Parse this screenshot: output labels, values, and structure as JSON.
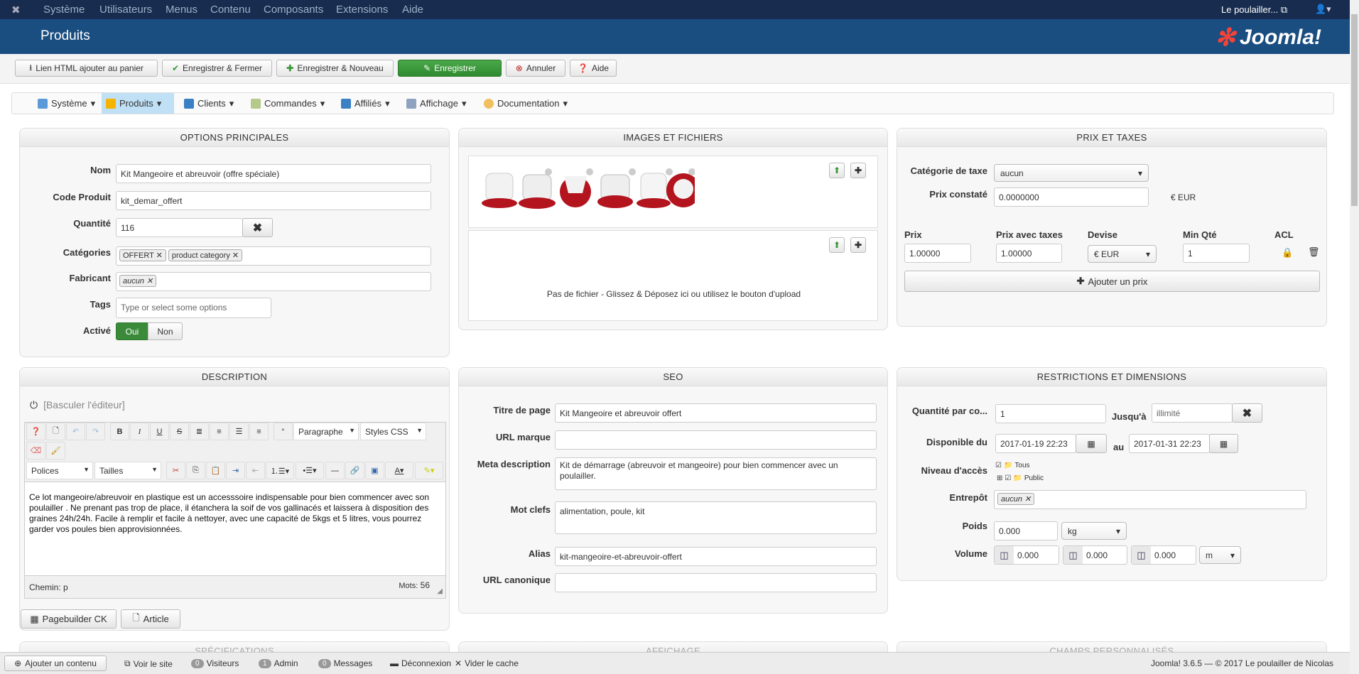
{
  "topnav": {
    "items": [
      "Système",
      "Utilisateurs",
      "Menus",
      "Contenu",
      "Composants",
      "Extensions",
      "Aide"
    ],
    "site": "Le poulailler...",
    "user_icon": "user-icon"
  },
  "header": {
    "title": "Produits",
    "logo": "Joomla!"
  },
  "toolbar": {
    "link_html": "Lien HTML ajouter au panier",
    "save_close": "Enregistrer & Fermer",
    "save_new": "Enregistrer & Nouveau",
    "save": "Enregistrer",
    "cancel": "Annuler",
    "help": "Aide"
  },
  "submenu": {
    "items": [
      "Système",
      "Produits",
      "Clients",
      "Commandes",
      "Affiliés",
      "Affichage",
      "Documentation"
    ],
    "active": "Produits"
  },
  "options": {
    "title": "OPTIONS PRINCIPALES",
    "nom_label": "Nom",
    "nom": "Kit Mangeoire et abreuvoir (offre spéciale)",
    "code_label": "Code Produit",
    "code": "kit_demar_offert",
    "qte_label": "Quantité",
    "qte": "116",
    "cat_label": "Catégories",
    "cats": [
      "OFFERT",
      "product category"
    ],
    "fab_label": "Fabricant",
    "fab": "aucun",
    "tags_label": "Tags",
    "tags_placeholder": "Type or select some options",
    "actif_label": "Activé",
    "oui": "Oui",
    "non": "Non"
  },
  "images": {
    "title": "IMAGES ET FICHIERS",
    "nofile": "Pas de fichier - Glissez & Déposez ici ou utilisez le bouton d'upload"
  },
  "prix": {
    "title": "PRIX ET TAXES",
    "taxe_label": "Catégorie de taxe",
    "taxe": "aucun",
    "constate_label": "Prix constaté",
    "constate": "0.0000000",
    "constate_cur": "€ EUR",
    "cols": [
      "Prix",
      "Prix avec taxes",
      "Devise",
      "Min Qté",
      "ACL"
    ],
    "row": {
      "prix": "1.00000",
      "prix_taxes": "1.00000",
      "devise": "€ EUR",
      "min_qte": "1"
    },
    "add": "Ajouter un prix"
  },
  "description": {
    "title": "DESCRIPTION",
    "toggle": "[Basculer l'éditeur]",
    "format": "Paragraphe",
    "styles": "Styles CSS",
    "fonts": "Polices",
    "sizes": "Tailles",
    "text": "Ce lot mangeoire/abreuvoir en plastique est un accesssoire indispensable pour bien commencer avec son poulailler . Ne prenant pas trop de place, il étanchera la soif de vos gallinacés et laissera à disposition des graines 24h/24h. Facile à remplir et facile à nettoyer, avec une capacité de 5kgs et 5 litres, vous pourrez garder vos poules bien approvisionnées.",
    "path_label": "Chemin:",
    "path": "p",
    "words_label": "Mots:",
    "words": "56",
    "pagebuilder": "Pagebuilder CK",
    "article": "Article"
  },
  "seo": {
    "title": "SEO",
    "titre_label": "Titre de page",
    "titre": "Kit Mangeoire et abreuvoir offert",
    "urlm_label": "URL marque",
    "urlm": "",
    "meta_label": "Meta description",
    "meta": "Kit de démarrage (abreuvoir et mangeoire) pour bien commencer avec un poulailler.",
    "mots_label": "Mot clefs",
    "mots": "alimentation, poule, kit",
    "alias_label": "Alias",
    "alias": "kit-mangeoire-et-abreuvoir-offert",
    "canon_label": "URL canonique",
    "canon": ""
  },
  "restrictions": {
    "title": "RESTRICTIONS ET DIMENSIONS",
    "qte_label": "Quantité par co...",
    "qte": "1",
    "jusqua_label": "Jusqu'à",
    "jusqua": "illimité",
    "dispo_label": "Disponible du",
    "dispo_from": "2017-01-19 22:23",
    "au_label": "au",
    "dispo_to": "2017-01-31 22:23",
    "acces_label": "Niveau d'accès",
    "acces": [
      "Tous",
      "Public"
    ],
    "entrepot_label": "Entrepôt",
    "entrepot": "aucun",
    "poids_label": "Poids",
    "poids": "0.000",
    "poids_unit": "kg",
    "volume_label": "Volume",
    "volume": [
      "0.000",
      "0.000",
      "0.000"
    ],
    "volume_unit": "m"
  },
  "row3": {
    "specs": "SPÉCIFICATIONS",
    "affichage": "AFFICHAGE",
    "champs": "CHAMPS PERSONNALISÉS"
  },
  "status": {
    "add": "Ajouter un contenu",
    "view": "Voir le site",
    "visitors_count": "0",
    "visitors": "Visiteurs",
    "admin_count": "1",
    "admin": "Admin",
    "messages_count": "0",
    "messages": "Messages",
    "logout": "Déconnexion",
    "cache": "Vider le cache",
    "footer": "Joomla! 3.6.5  —  © 2017 Le poulailler de Nicolas"
  },
  "colors": {
    "topnav": "#172c4e",
    "header": "#1a4d80",
    "green": "#3a963a",
    "active_tab": "#bfe0f5"
  }
}
